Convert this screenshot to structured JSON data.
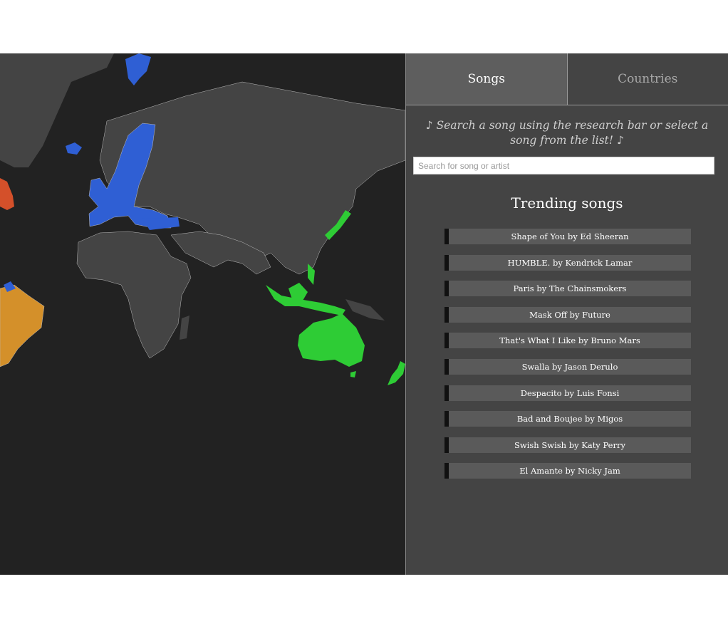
{
  "map": {
    "background": "#222222",
    "land_color": "#444444",
    "border_color": "#bbbbbb",
    "region_colors": {
      "europe": "#2f5fd4",
      "asia_pacific": "#2ecc35",
      "north_america": "#d4502a",
      "south_america": "#d4902a"
    }
  },
  "tabs": [
    {
      "label": "Songs",
      "active": true
    },
    {
      "label": "Countries",
      "active": false
    }
  ],
  "instructions": "♪ Search a song using the research bar or select a song from the list! ♪",
  "search": {
    "placeholder": "Search for song or artist",
    "value": ""
  },
  "trending": {
    "title": "Trending songs",
    "songs": [
      "Shape of You by Ed Sheeran",
      "HUMBLE. by Kendrick Lamar",
      "Paris by The Chainsmokers",
      "Mask Off by Future",
      "That's What I Like by Bruno Mars",
      "Swalla by Jason Derulo",
      "Despacito by Luis Fonsi",
      "Bad and Boujee by Migos",
      "Swish Swish by Katy Perry",
      "El Amante by Nicky Jam"
    ]
  }
}
